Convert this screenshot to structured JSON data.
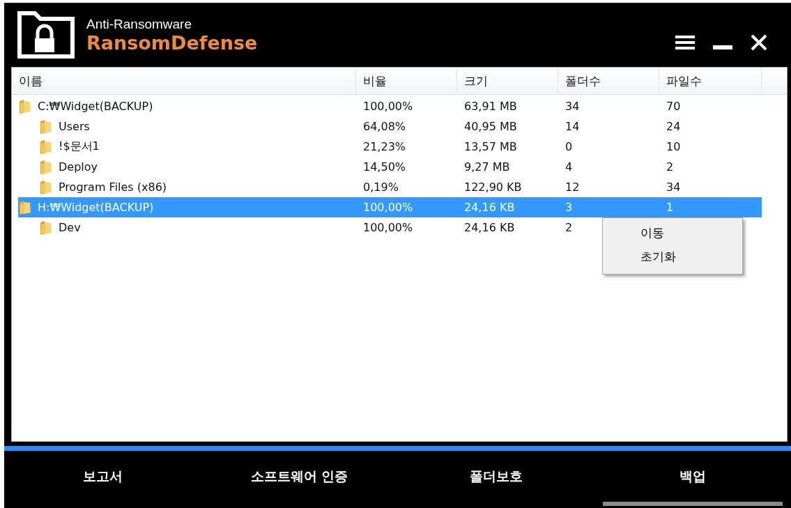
{
  "header": {
    "subtitle": "Anti-Ransomware",
    "title": "RansomDefense"
  },
  "table": {
    "columns": [
      "이름",
      "비율",
      "크기",
      "폴더수",
      "파일수"
    ],
    "rows": [
      {
        "name": "C:₩Widget(BACKUP)",
        "ratio": "100,00%",
        "size": "63,91 MB",
        "folders": "34",
        "files": "70",
        "selected": false,
        "children": [
          {
            "name": "Users",
            "ratio": "64,08%",
            "size": "40,95 MB",
            "folders": "14",
            "files": "24",
            "selected": false
          },
          {
            "name": "!$문서1",
            "ratio": "21,23%",
            "size": "13,57 MB",
            "folders": "0",
            "files": "10",
            "selected": false
          },
          {
            "name": "Deploy",
            "ratio": "14,50%",
            "size": "9,27 MB",
            "folders": "4",
            "files": "2",
            "selected": false
          },
          {
            "name": "Program Files (x86)",
            "ratio": "0,19%",
            "size": "122,90 KB",
            "folders": "12",
            "files": "34",
            "selected": false
          }
        ]
      },
      {
        "name": "H:₩Widget(BACKUP)",
        "ratio": "100,00%",
        "size": "24,16 KB",
        "folders": "3",
        "files": "1",
        "selected": true,
        "children": [
          {
            "name": "Dev",
            "ratio": "100,00%",
            "size": "24,16 KB",
            "folders": "2",
            "selected": false
          }
        ]
      }
    ]
  },
  "context_menu": {
    "items": [
      "이동",
      "초기화"
    ]
  },
  "tabs": [
    {
      "label": "보고서",
      "selected": false
    },
    {
      "label": "소프트웨어 인증",
      "selected": false
    },
    {
      "label": "폴더보호",
      "selected": false
    },
    {
      "label": "백업",
      "selected": true
    }
  ]
}
